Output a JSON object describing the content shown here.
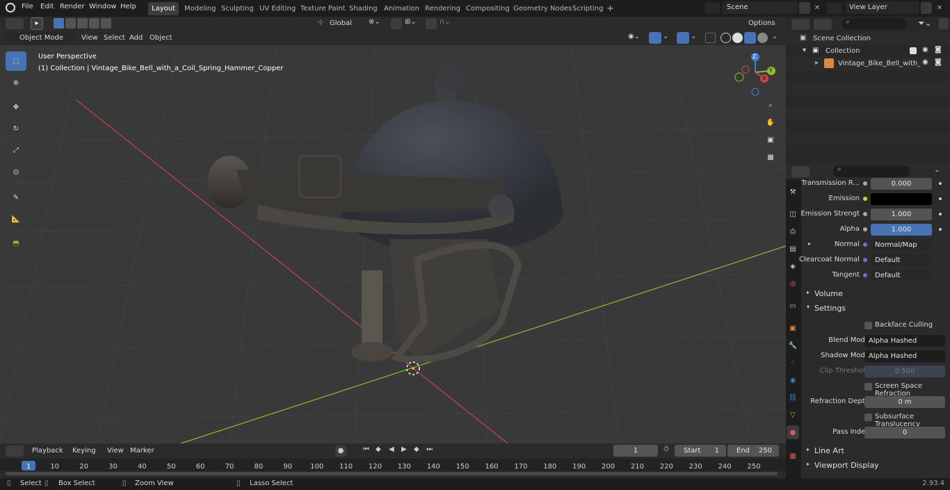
{
  "menu": {
    "file": "File",
    "edit": "Edit",
    "render": "Render",
    "window": "Window",
    "help": "Help"
  },
  "workspaces": [
    "Layout",
    "Modeling",
    "Sculpting",
    "UV Editing",
    "Texture Paint",
    "Shading",
    "Animation",
    "Rendering",
    "Compositing",
    "Geometry Nodes",
    "Scripting"
  ],
  "scene": {
    "name": "Scene",
    "view_layer": "View Layer"
  },
  "toolhdr": {
    "transform": "Global",
    "options": "Options"
  },
  "viewport_header": {
    "mode": "Object Mode",
    "view": "View",
    "select": "Select",
    "add": "Add",
    "object": "Object"
  },
  "viewport": {
    "perspective": "User Perspective",
    "collection_info": "(1) Collection | Vintage_Bike_Bell_with_a_Coil_Spring_Hammer_Copper"
  },
  "gizmo": {
    "z": "Z",
    "y": "Y",
    "x": "X"
  },
  "outliner": {
    "scene_collection": "Scene Collection",
    "collection": "Collection",
    "object": "Vintage_Bike_Bell_with_a"
  },
  "properties": {
    "rows": [
      {
        "label": "Transmission R...",
        "value": "0.000"
      },
      {
        "label": "Emission",
        "value": ""
      },
      {
        "label": "Emission Strengt",
        "value": "1.000"
      },
      {
        "label": "Alpha",
        "value": "1.000"
      },
      {
        "label": "Normal",
        "value": "Normal/Map"
      },
      {
        "label": "Clearcoat Normal",
        "value": "Default"
      },
      {
        "label": "Tangent",
        "value": "Default"
      }
    ],
    "volume": "Volume",
    "settings": "Settings",
    "backface": "Backface Culling",
    "blend_label": "Blend Mode",
    "blend_value": "Alpha Hashed",
    "shadow_label": "Shadow Mode",
    "shadow_value": "Alpha Hashed",
    "clip_label": "Clip Threshold",
    "clip_value": "0.500",
    "ssr": "Screen Space Refraction",
    "refr_label": "Refraction Depth",
    "refr_value": "0 m",
    "sss": "Subsurface Translucency",
    "pass_label": "Pass Index",
    "pass_value": "0",
    "line_art": "Line Art",
    "viewport_display": "Viewport Display"
  },
  "timeline": {
    "playback": "Playback",
    "keying": "Keying",
    "view": "View",
    "marker": "Marker",
    "current": "1",
    "start_label": "Start",
    "start": "1",
    "end_label": "End",
    "end": "250",
    "ticks": [
      "1",
      "10",
      "20",
      "30",
      "40",
      "50",
      "60",
      "70",
      "80",
      "90",
      "100",
      "110",
      "120",
      "130",
      "140",
      "150",
      "160",
      "170",
      "180",
      "190",
      "200",
      "210",
      "220",
      "230",
      "240",
      "250"
    ]
  },
  "status": {
    "select": "Select",
    "box_select": "Box Select",
    "zoom_view": "Zoom View",
    "lasso_select": "Lasso Select",
    "version": "2.93.4"
  },
  "colors": {
    "accent": "#4772b3",
    "x_axis": "#c8444e",
    "y_axis": "#8fbf2a",
    "z_axis": "#3f7fd8",
    "emission": "#000000"
  }
}
